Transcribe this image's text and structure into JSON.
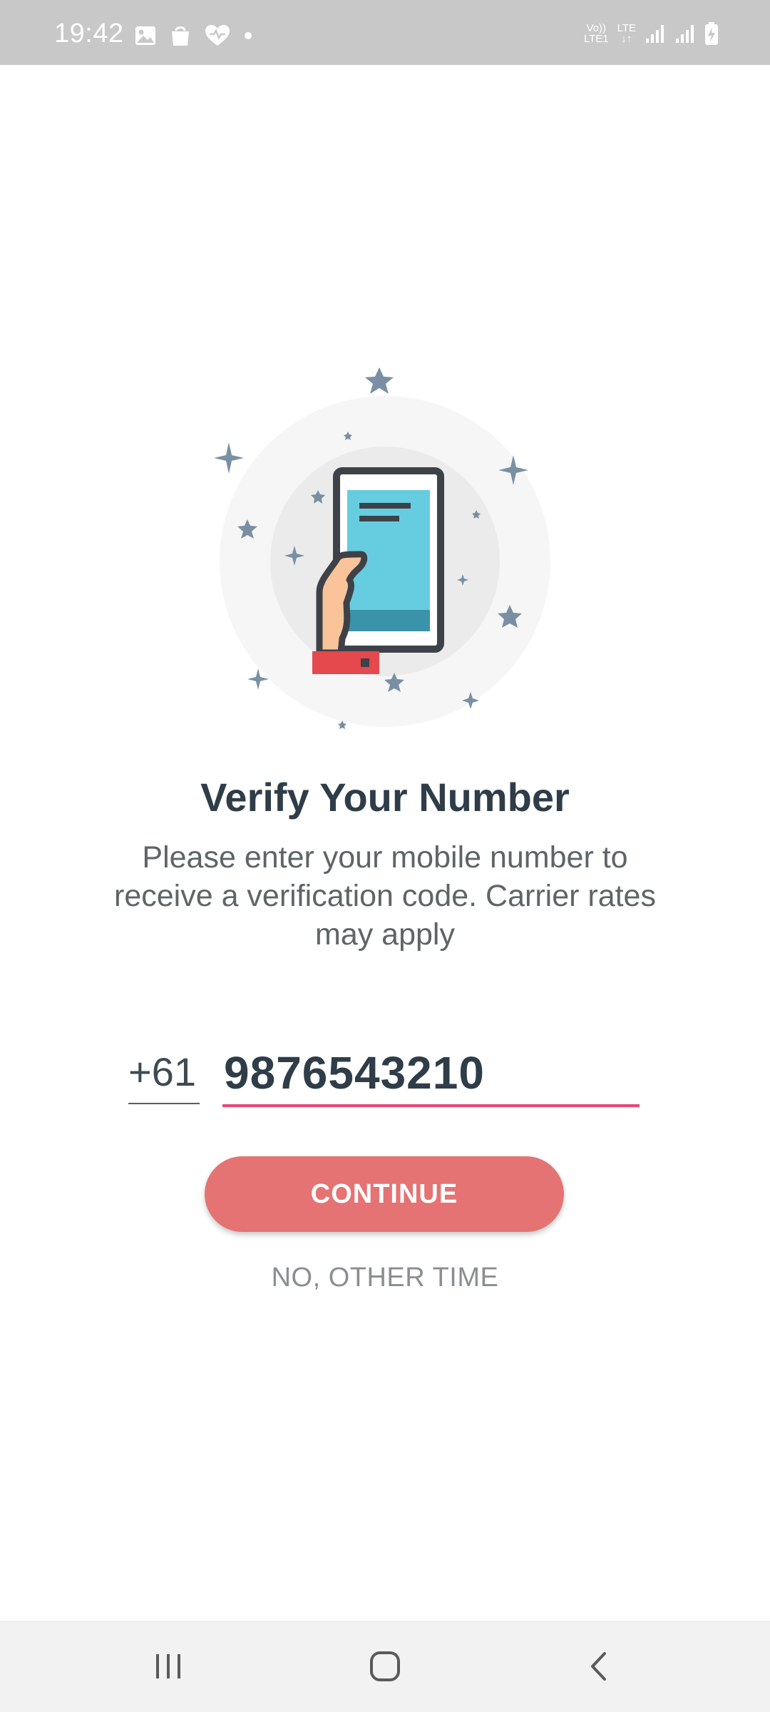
{
  "status_bar": {
    "time": "19:42",
    "left_icons": [
      "gallery-icon",
      "shopping-bag-icon",
      "health-heart-icon",
      "dot-icon"
    ],
    "network_labels": {
      "volte_top": "Vo))",
      "volte_bottom": "LTE1",
      "lte_top": "LTE",
      "lte_bottom": "↓↑"
    },
    "right_icons": [
      "signal-icon",
      "signal-icon",
      "battery-charging-icon"
    ]
  },
  "illustration": {
    "name": "hand-holding-phone-illustration",
    "colors": {
      "outer_circle": "#f6f6f6",
      "inner_circle": "#ebebeb",
      "screen": "#66cde0",
      "screen_band": "#3a93a8",
      "phone_frame": "#3e4248",
      "hand": "#f9c49a",
      "cuff": "#e5484d",
      "stars": "#7a8fa3"
    }
  },
  "title": "Verify Your Number",
  "subtitle": "Please enter your mobile number to receive a verification code. Carrier rates may apply",
  "phone_form": {
    "country_code": "+61",
    "phone_value": "9876543210"
  },
  "actions": {
    "continue_label": "CONTINUE",
    "skip_label": "NO, OTHER TIME"
  },
  "nav_bar": {
    "buttons": [
      "recent-apps-icon",
      "home-icon",
      "back-icon"
    ]
  },
  "colors": {
    "accent": "#e57373",
    "underline_active": "#e8457a",
    "title": "#2e3d48",
    "subtitle": "#5f6467",
    "status_bar": "#c8c8c8"
  }
}
